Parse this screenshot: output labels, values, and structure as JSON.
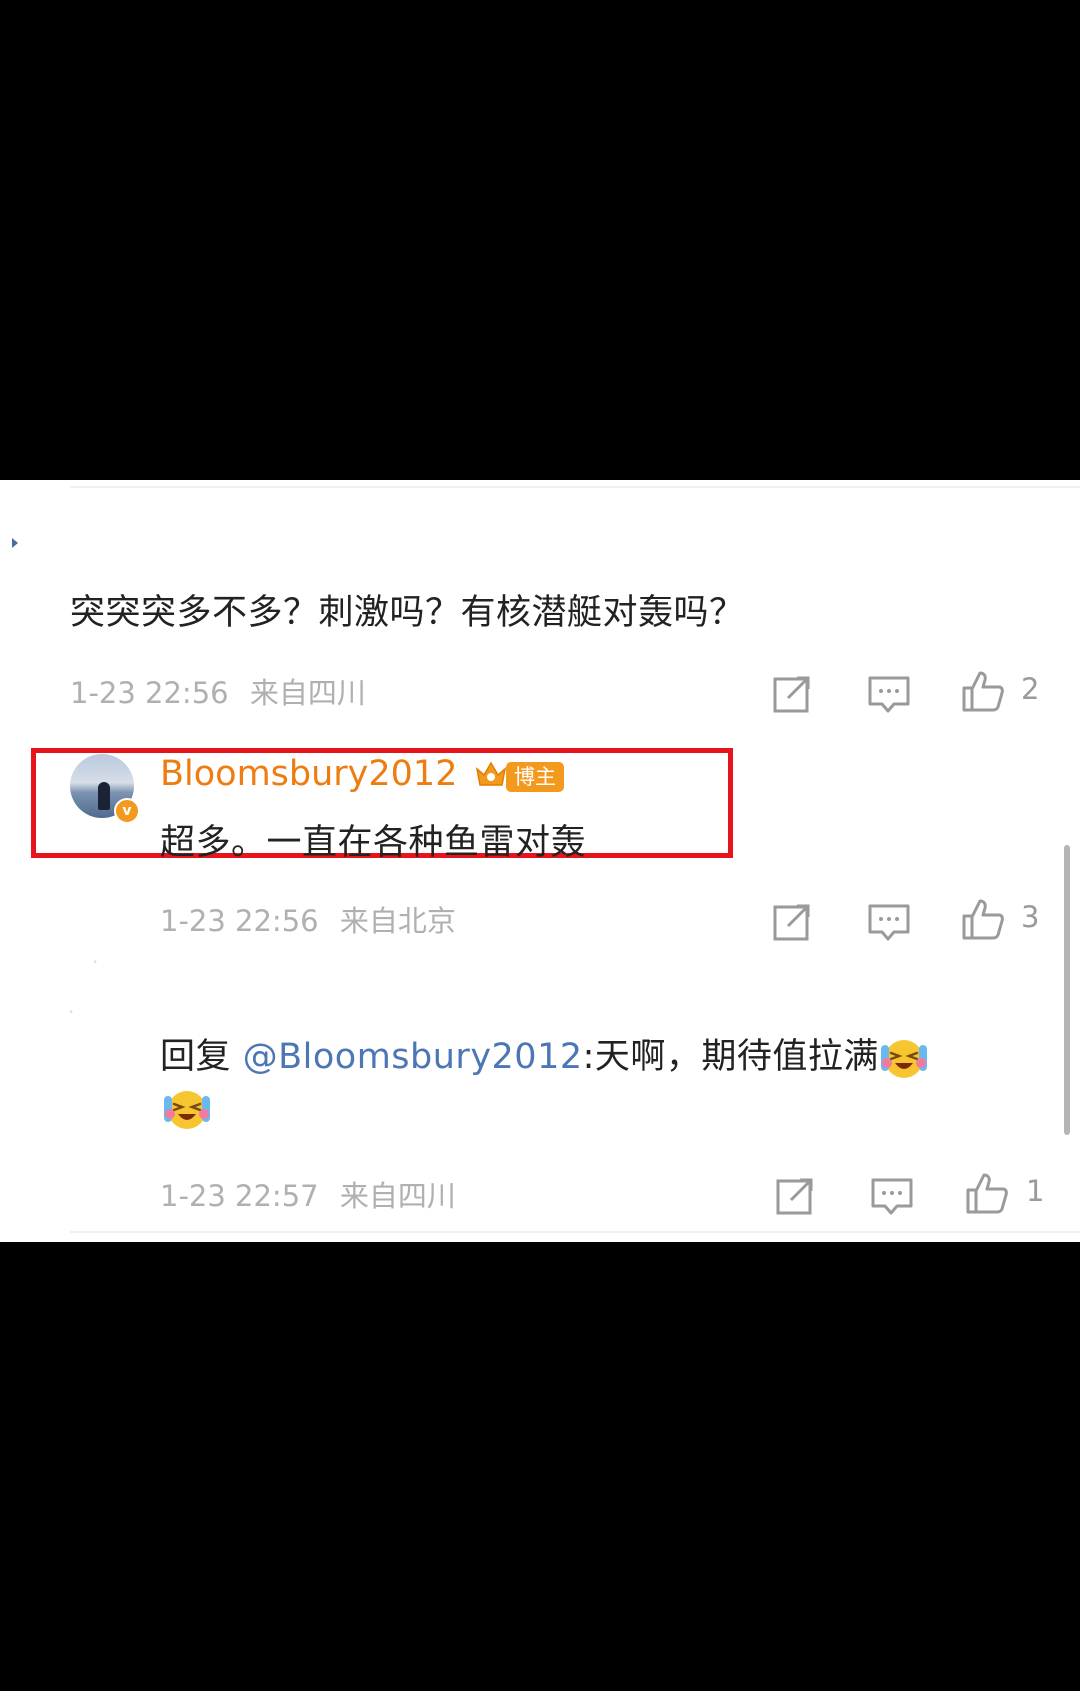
{
  "comments": [
    {
      "text": "突突突多不多？刺激吗？有核潜艇对轰吗？",
      "time": "1-23 22:56",
      "location": "来自四川",
      "likes": "2"
    }
  ],
  "reply": {
    "username": "Bloomsbury2012",
    "badge": "博主",
    "text": "超多。一直在各种鱼雷对轰",
    "time": "1-23 22:56",
    "location": "来自北京",
    "likes": "3"
  },
  "sub_reply": {
    "prefix": "回复 ",
    "mention": "@Bloomsbury2012",
    "text": ":天啊，期待值拉满",
    "emoji_1": "laughing-crying-emoji",
    "emoji_2": "laughing-crying-emoji",
    "time": "1-23 22:57",
    "location": "来自四川",
    "likes": "1"
  },
  "colors": {
    "accent_orange": "#ee7d11",
    "mention_blue": "#4d76b5",
    "highlight_red": "#e8141c"
  },
  "icons": [
    "share-icon",
    "comment-icon",
    "like-icon"
  ]
}
